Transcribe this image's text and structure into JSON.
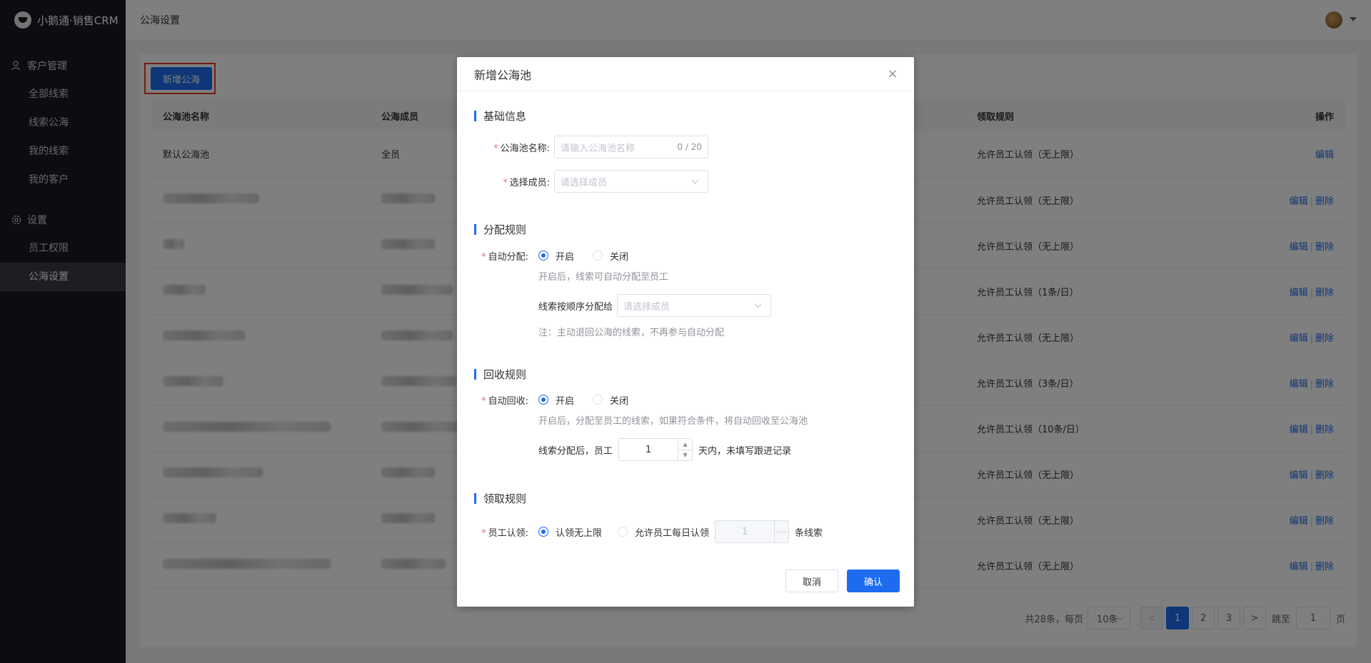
{
  "app": {
    "name": "小鹅通·销售CRM"
  },
  "sidebar": {
    "groups": [
      {
        "label": "客户管理",
        "items": [
          "全部线索",
          "线索公海",
          "我的线索",
          "我的客户"
        ]
      },
      {
        "label": "设置",
        "items": [
          "员工权限",
          "公海设置"
        ]
      }
    ],
    "active_item": "公海设置"
  },
  "header": {
    "breadcrumb": "公海设置"
  },
  "main": {
    "add_button": "新增公海",
    "table": {
      "columns": [
        "公海池名称",
        "公海成员",
        "领取规则",
        "操作"
      ],
      "rows": [
        {
          "name": "默认公海池",
          "members": "全员",
          "rule": "允许员工认领（无上限）",
          "ops": [
            "编辑"
          ]
        },
        {
          "name": "",
          "members": "",
          "rule": "允许员工认领（无上限）",
          "ops": [
            "编辑",
            "删除"
          ]
        },
        {
          "name": "",
          "members": "",
          "rule": "允许员工认领（无上限）",
          "ops": [
            "编辑",
            "删除"
          ]
        },
        {
          "name": "",
          "members": "",
          "rule": "允许员工认领（1条/日）",
          "ops": [
            "编辑",
            "删除"
          ]
        },
        {
          "name": "",
          "members": "",
          "rule": "允许员工认领（无上限）",
          "ops": [
            "编辑",
            "删除"
          ]
        },
        {
          "name": "",
          "members": "",
          "rule": "允许员工认领（3条/日）",
          "ops": [
            "编辑",
            "删除"
          ]
        },
        {
          "name": "",
          "members": "",
          "rule": "允许员工认领（10条/日）",
          "ops": [
            "编辑",
            "删除"
          ]
        },
        {
          "name": "",
          "members": "",
          "rule": "允许员工认领（无上限）",
          "ops": [
            "编辑",
            "删除"
          ]
        },
        {
          "name": "",
          "members": "",
          "rule": "允许员工认领（无上限）",
          "ops": [
            "编辑",
            "删除"
          ]
        },
        {
          "name": "",
          "members": "",
          "rule": "允许员工认领（无上限）",
          "ops": [
            "编辑",
            "删除"
          ]
        }
      ]
    },
    "pagination": {
      "total_text": "共28条，每页",
      "page_size": "10条",
      "prev": "<",
      "pages": [
        "1",
        "2",
        "3"
      ],
      "current": "1",
      "next": ">",
      "goto_prefix": "跳至",
      "goto_value": "1",
      "goto_suffix": "页"
    }
  },
  "dialog": {
    "title": "新增公海池",
    "close": "×",
    "basic": {
      "title": "基础信息",
      "name_label": "公海池名称:",
      "name_placeholder": "请输入公海池名称",
      "name_counter": "0 / 20",
      "members_label": "选择成员:",
      "members_placeholder": "请选择成员"
    },
    "assign": {
      "title": "分配规则",
      "auto_label": "自动分配:",
      "on": "开启",
      "off": "关闭",
      "hint": "开启后，线索可自动分配至员工",
      "order_label": "线索按顺序分配给",
      "order_placeholder": "请选择成员",
      "note": "注：主动退回公海的线索，不再参与自动分配"
    },
    "recycle": {
      "title": "回收规则",
      "auto_label": "自动回收:",
      "on": "开启",
      "off": "关闭",
      "hint": "开启后，分配至员工的线索，如果符合条件，将自动回收至公海池",
      "prefix": "线索分配后，员工",
      "days": "1",
      "suffix": "天内，未填写跟进记录"
    },
    "claim": {
      "title": "领取规则",
      "label": "员工认领:",
      "unlimited": "认领无上限",
      "daily": "允许员工每日认领",
      "daily_value": "1",
      "unit": "条线索"
    },
    "cancel": "取消",
    "confirm": "确认"
  }
}
